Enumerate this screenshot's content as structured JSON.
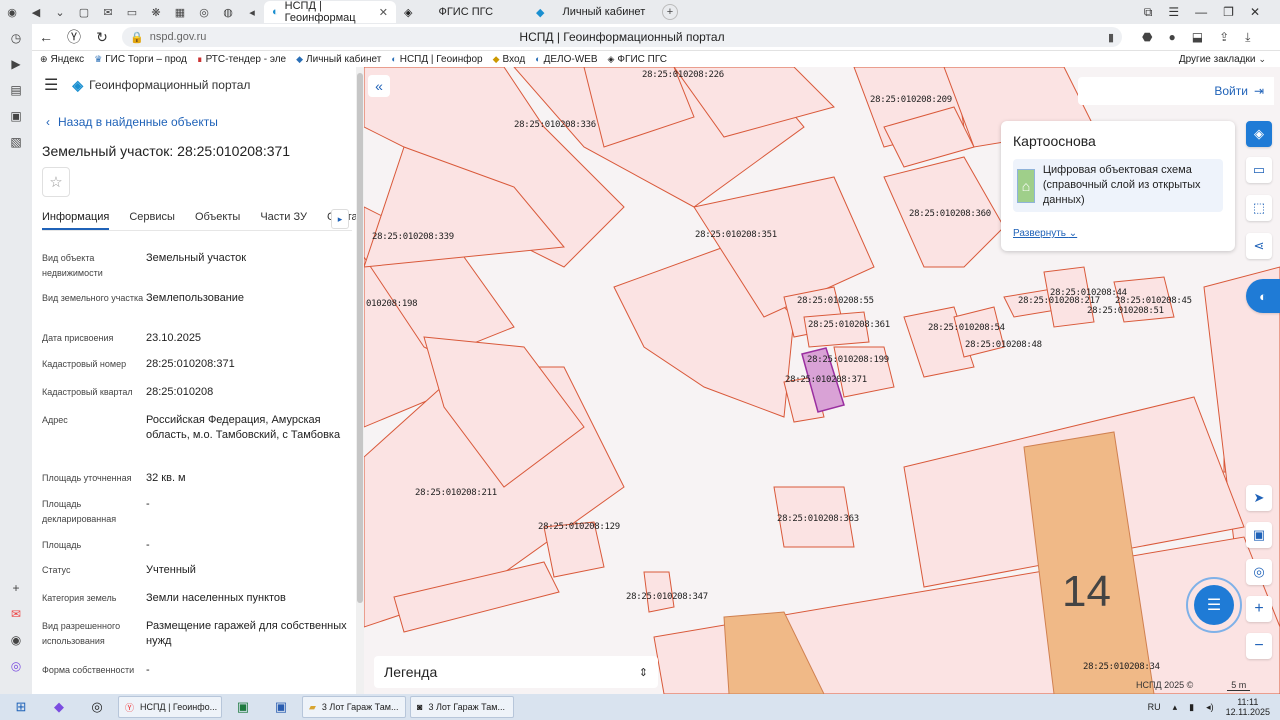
{
  "browser": {
    "tabs": [
      {
        "label": "НСПД | Геоинформац",
        "active": true
      },
      {
        "label": "ФГИС ПГС",
        "active": false
      },
      {
        "label": "Личный кабинет",
        "active": false
      }
    ],
    "url": "nspd.gov.ru",
    "page_title": "НСПД | Геоинформационный портал",
    "bookmarks": [
      "Яндекс",
      "ГИС Торги – прод",
      "РТС-тендер - эле",
      "Личный кабинет",
      "НСПД | Геоинфор",
      "Вход",
      "ДЕЛО-WEB",
      "ФГИС ПГС"
    ],
    "other_bookmarks": "Другие закладки"
  },
  "panel": {
    "portal_name": "Геоинформационный портал",
    "back_link": "Назад в найденные объекты",
    "title": "Земельный участок: 28:25:010208:371",
    "tabs": [
      "Информация",
      "Сервисы",
      "Объекты",
      "Части ЗУ",
      "Соста"
    ],
    "fields": [
      {
        "k": "Вид объекта недвижимости",
        "v": "Земельный участок"
      },
      {
        "k": "Вид земельного участка",
        "v": "Землепользование"
      },
      {
        "k": "Дата присвоения",
        "v": "23.10.2025"
      },
      {
        "k": "Кадастровый номер",
        "v": "28:25:010208:371"
      },
      {
        "k": "Кадастровый квартал",
        "v": "28:25:010208"
      },
      {
        "k": "Адрес",
        "v": "Российская Федерация, Амурская область, м.о. Тамбовский, с Тамбовка"
      },
      {
        "k": "Площадь уточненная",
        "v": "32 кв. м"
      },
      {
        "k": "Площадь декларированная",
        "v": "-"
      },
      {
        "k": "Площадь",
        "v": "-"
      },
      {
        "k": "Статус",
        "v": "Учтенный"
      },
      {
        "k": "Категория земель",
        "v": "Земли населенных пунктов"
      },
      {
        "k": "Вид разрешенного использования",
        "v": "Размещение гаражей для собственных нужд"
      },
      {
        "k": "Форма собственности",
        "v": "-"
      }
    ]
  },
  "map": {
    "login": "Войти",
    "basemap_title": "Картооснова",
    "basemap_layer": "Цифровая объектовая схема (справочный слой из открытых данных)",
    "expand": "Развернуть",
    "legend": "Легенда",
    "attribution": "НСПД 2025 ©",
    "scale": "5 m",
    "building_number": "14",
    "parcel_labels": [
      "28:25:010208:226",
      "28:25:010208:209",
      "28:25:010208:336",
      "28:25:010208:360",
      "28:25:010208:339",
      "28:25:010208:351",
      "010208:198",
      "28:25:010208:55",
      "28:25:010208:361",
      "28:25:010208:199",
      "28:25:010208:371",
      "28:25:010208:54",
      "28:25:010208:48",
      "28:25:010208:44",
      "28:25:010208:217",
      "28:25:010208:45",
      "28:25:010208:51",
      "28:25:010208:211",
      "28:25:010208:129",
      "28:25:010208:363",
      "28:25:010208:347",
      "28:25:010208:34"
    ],
    "accent": "#1f7bd6",
    "boundary_color": "#d9593a",
    "selected_fill": "#d9a2d6"
  },
  "taskbar": {
    "tasks": [
      "НСПД | Геоинфо...",
      "",
      "",
      "3 Лот Гараж Там...",
      "3 Лот Гараж Там..."
    ],
    "lang": "RU",
    "time": "11:11",
    "date": "12.11.2025"
  }
}
